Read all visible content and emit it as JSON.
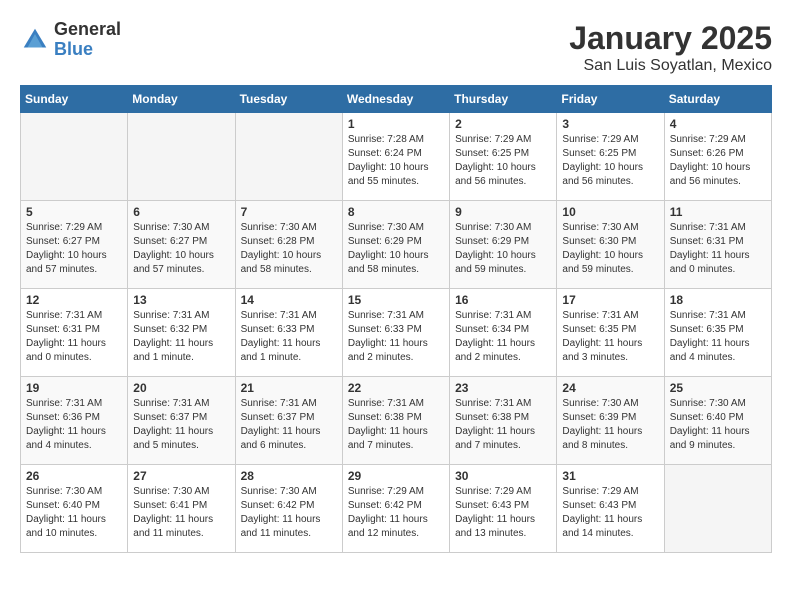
{
  "header": {
    "logo_general": "General",
    "logo_blue": "Blue",
    "title": "January 2025",
    "location": "San Luis Soyatlan, Mexico"
  },
  "days_of_week": [
    "Sunday",
    "Monday",
    "Tuesday",
    "Wednesday",
    "Thursday",
    "Friday",
    "Saturday"
  ],
  "weeks": [
    [
      {
        "day": "",
        "info": ""
      },
      {
        "day": "",
        "info": ""
      },
      {
        "day": "",
        "info": ""
      },
      {
        "day": "1",
        "info": "Sunrise: 7:28 AM\nSunset: 6:24 PM\nDaylight: 10 hours\nand 55 minutes."
      },
      {
        "day": "2",
        "info": "Sunrise: 7:29 AM\nSunset: 6:25 PM\nDaylight: 10 hours\nand 56 minutes."
      },
      {
        "day": "3",
        "info": "Sunrise: 7:29 AM\nSunset: 6:25 PM\nDaylight: 10 hours\nand 56 minutes."
      },
      {
        "day": "4",
        "info": "Sunrise: 7:29 AM\nSunset: 6:26 PM\nDaylight: 10 hours\nand 56 minutes."
      }
    ],
    [
      {
        "day": "5",
        "info": "Sunrise: 7:29 AM\nSunset: 6:27 PM\nDaylight: 10 hours\nand 57 minutes."
      },
      {
        "day": "6",
        "info": "Sunrise: 7:30 AM\nSunset: 6:27 PM\nDaylight: 10 hours\nand 57 minutes."
      },
      {
        "day": "7",
        "info": "Sunrise: 7:30 AM\nSunset: 6:28 PM\nDaylight: 10 hours\nand 58 minutes."
      },
      {
        "day": "8",
        "info": "Sunrise: 7:30 AM\nSunset: 6:29 PM\nDaylight: 10 hours\nand 58 minutes."
      },
      {
        "day": "9",
        "info": "Sunrise: 7:30 AM\nSunset: 6:29 PM\nDaylight: 10 hours\nand 59 minutes."
      },
      {
        "day": "10",
        "info": "Sunrise: 7:30 AM\nSunset: 6:30 PM\nDaylight: 10 hours\nand 59 minutes."
      },
      {
        "day": "11",
        "info": "Sunrise: 7:31 AM\nSunset: 6:31 PM\nDaylight: 11 hours\nand 0 minutes."
      }
    ],
    [
      {
        "day": "12",
        "info": "Sunrise: 7:31 AM\nSunset: 6:31 PM\nDaylight: 11 hours\nand 0 minutes."
      },
      {
        "day": "13",
        "info": "Sunrise: 7:31 AM\nSunset: 6:32 PM\nDaylight: 11 hours\nand 1 minute."
      },
      {
        "day": "14",
        "info": "Sunrise: 7:31 AM\nSunset: 6:33 PM\nDaylight: 11 hours\nand 1 minute."
      },
      {
        "day": "15",
        "info": "Sunrise: 7:31 AM\nSunset: 6:33 PM\nDaylight: 11 hours\nand 2 minutes."
      },
      {
        "day": "16",
        "info": "Sunrise: 7:31 AM\nSunset: 6:34 PM\nDaylight: 11 hours\nand 2 minutes."
      },
      {
        "day": "17",
        "info": "Sunrise: 7:31 AM\nSunset: 6:35 PM\nDaylight: 11 hours\nand 3 minutes."
      },
      {
        "day": "18",
        "info": "Sunrise: 7:31 AM\nSunset: 6:35 PM\nDaylight: 11 hours\nand 4 minutes."
      }
    ],
    [
      {
        "day": "19",
        "info": "Sunrise: 7:31 AM\nSunset: 6:36 PM\nDaylight: 11 hours\nand 4 minutes."
      },
      {
        "day": "20",
        "info": "Sunrise: 7:31 AM\nSunset: 6:37 PM\nDaylight: 11 hours\nand 5 minutes."
      },
      {
        "day": "21",
        "info": "Sunrise: 7:31 AM\nSunset: 6:37 PM\nDaylight: 11 hours\nand 6 minutes."
      },
      {
        "day": "22",
        "info": "Sunrise: 7:31 AM\nSunset: 6:38 PM\nDaylight: 11 hours\nand 7 minutes."
      },
      {
        "day": "23",
        "info": "Sunrise: 7:31 AM\nSunset: 6:38 PM\nDaylight: 11 hours\nand 7 minutes."
      },
      {
        "day": "24",
        "info": "Sunrise: 7:30 AM\nSunset: 6:39 PM\nDaylight: 11 hours\nand 8 minutes."
      },
      {
        "day": "25",
        "info": "Sunrise: 7:30 AM\nSunset: 6:40 PM\nDaylight: 11 hours\nand 9 minutes."
      }
    ],
    [
      {
        "day": "26",
        "info": "Sunrise: 7:30 AM\nSunset: 6:40 PM\nDaylight: 11 hours\nand 10 minutes."
      },
      {
        "day": "27",
        "info": "Sunrise: 7:30 AM\nSunset: 6:41 PM\nDaylight: 11 hours\nand 11 minutes."
      },
      {
        "day": "28",
        "info": "Sunrise: 7:30 AM\nSunset: 6:42 PM\nDaylight: 11 hours\nand 11 minutes."
      },
      {
        "day": "29",
        "info": "Sunrise: 7:29 AM\nSunset: 6:42 PM\nDaylight: 11 hours\nand 12 minutes."
      },
      {
        "day": "30",
        "info": "Sunrise: 7:29 AM\nSunset: 6:43 PM\nDaylight: 11 hours\nand 13 minutes."
      },
      {
        "day": "31",
        "info": "Sunrise: 7:29 AM\nSunset: 6:43 PM\nDaylight: 11 hours\nand 14 minutes."
      },
      {
        "day": "",
        "info": ""
      }
    ]
  ]
}
